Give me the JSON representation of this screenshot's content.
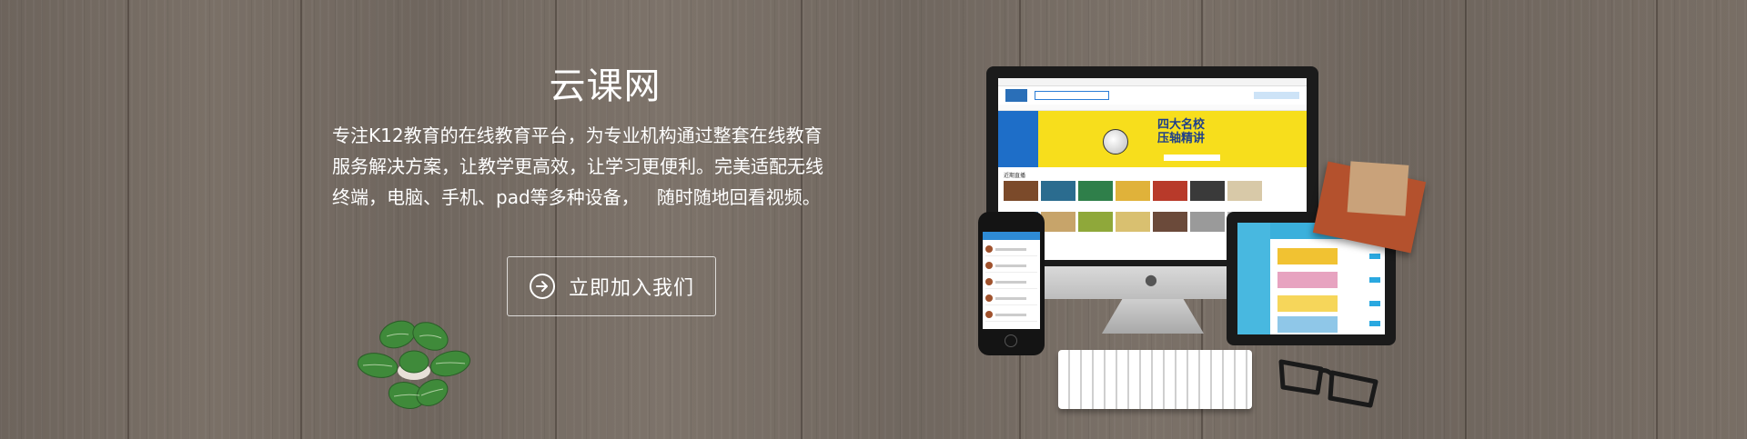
{
  "hero": {
    "title": "云课网",
    "description": "专注K12教育的在线教育平台，为专业机构通过整套在线教育\n服务解决方案，让教学更高效，让学习更便利。完美适配无线\n终端，电脑、手机、pad等多种设备，   随时随地回看视频。",
    "cta_label": "立即加入我们",
    "cta_icon": "arrow-right-circle-icon"
  },
  "monitor_screen": {
    "banner_title_line1": "四大名校",
    "banner_title_line2": "压轴精讲",
    "section_label": "近期直播"
  },
  "colors": {
    "text": "#ffffff",
    "banner_yellow": "#f7de1c",
    "brand_blue": "#1e6ec8",
    "wood": "#756b62"
  }
}
